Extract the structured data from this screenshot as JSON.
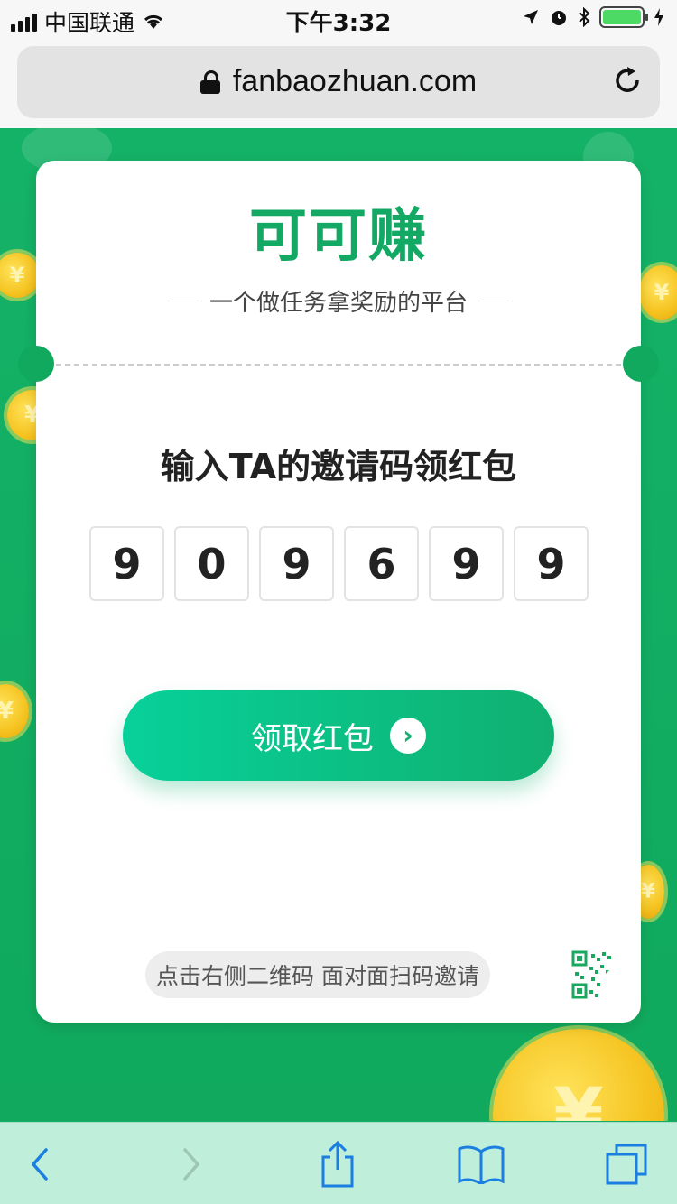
{
  "status_bar": {
    "carrier": "中国联通",
    "time": "下午3:32",
    "battery_color": "#4cd964"
  },
  "browser": {
    "url": "fanbaozhuan.com",
    "lock_icon": "lock-icon",
    "reload_icon": "reload-icon"
  },
  "card": {
    "brand": "可可赚",
    "tagline": "一个做任务拿奖励的平台",
    "invite_title": "输入TA的邀请码领红包",
    "code_digits": [
      "9",
      "0",
      "9",
      "6",
      "9",
      "9"
    ],
    "claim_button": "领取红包",
    "hint": "点击右侧二维码 面对面扫码邀请"
  },
  "toolbar": {
    "back": "back-icon",
    "forward": "forward-icon",
    "share": "share-icon",
    "bookmarks": "bookmarks-icon",
    "tabs": "tabs-icon"
  },
  "colors": {
    "brand_green": "#13a964",
    "background": "#12b064",
    "button_start": "#07d19a",
    "button_end": "#10b070",
    "link_blue": "#1a7fe0"
  }
}
